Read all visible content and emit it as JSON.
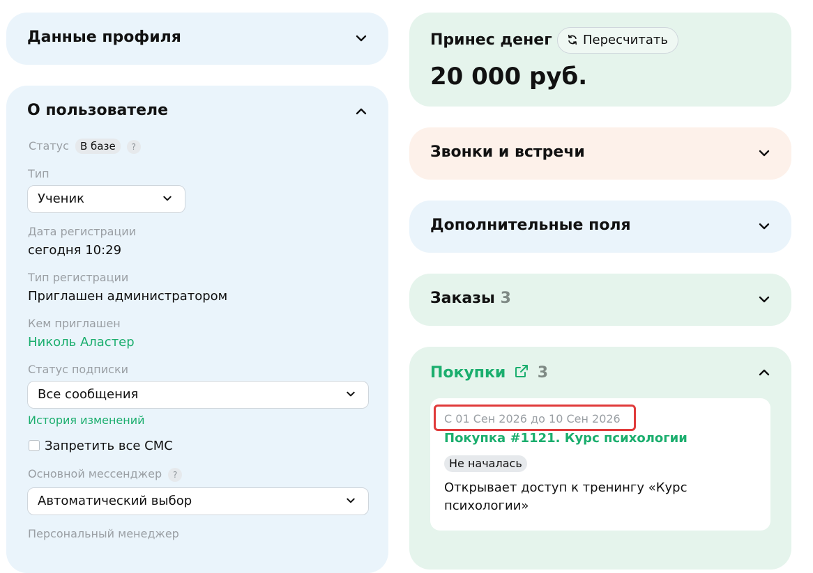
{
  "left": {
    "profile_section": {
      "title": "Данные профиля"
    },
    "about_section": {
      "title": "О пользователе",
      "status": {
        "label": "Статус",
        "badge": "В базе",
        "help": "?"
      },
      "type": {
        "label": "Тип",
        "value": "Ученик"
      },
      "reg_date": {
        "label": "Дата регистрации",
        "value": "сегодня 10:29"
      },
      "reg_type": {
        "label": "Тип регистрации",
        "value": "Приглашен администратором"
      },
      "invited_by": {
        "label": "Кем приглашен",
        "value": "Николь Аластер"
      },
      "subscription": {
        "label": "Статус подписки",
        "value": "Все сообщения"
      },
      "history_link": "История изменений",
      "forbid_sms": {
        "label": "Запретить все СМС",
        "checked": false
      },
      "messenger": {
        "label": "Основной мессенджер",
        "help": "?",
        "value": "Автоматический выбор"
      },
      "manager": {
        "label": "Персональный менеджер"
      }
    }
  },
  "right": {
    "money_section": {
      "title": "Принес денег",
      "recalc_label": "Пересчитать",
      "amount": "20 000 руб."
    },
    "calls_section": {
      "title": "Звонки и встречи"
    },
    "extra_section": {
      "title": "Дополнительные поля"
    },
    "orders_section": {
      "title": "Заказы",
      "count": "3"
    },
    "purchases_section": {
      "title": "Покупки",
      "count": "3",
      "items": [
        {
          "period": "С 01 Сен 2026 до 10 Сен 2026",
          "title": "Покупка #1121. Курс психологии",
          "status": "Не началась",
          "description": "Открывает доступ к тренингу «Курс психологии»"
        }
      ]
    }
  },
  "colors": {
    "accent_green": "#1bae6e",
    "highlight_red": "#e03a3a",
    "card_blue": "#eaf4fb",
    "card_green": "#e5f4ec",
    "card_peach": "#fdf1ea"
  },
  "icons": [
    "chevron-down-icon",
    "chevron-up-icon",
    "refresh-icon",
    "external-link-icon",
    "help-icon"
  ]
}
